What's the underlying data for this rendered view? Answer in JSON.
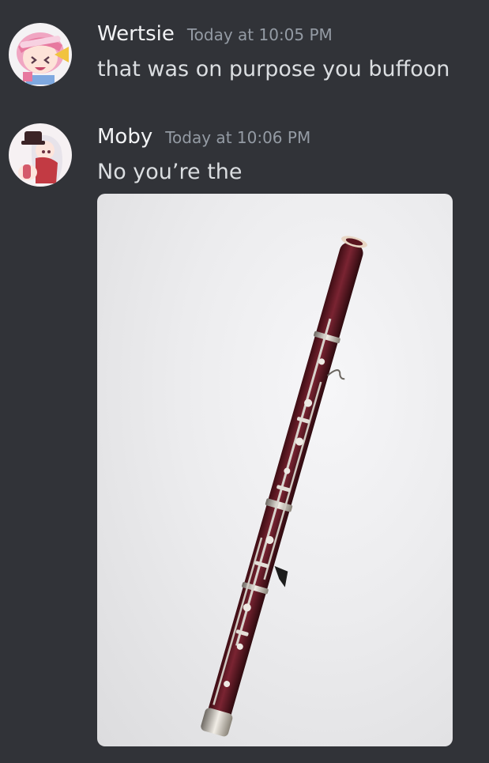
{
  "messages": [
    {
      "username": "Wertsie",
      "timestamp": "Today at 10:05 PM",
      "text": "that was on purpose you buffoon",
      "avatar_icon": "anime-pink-hair-avatar"
    },
    {
      "username": "Moby",
      "timestamp": "Today at 10:06 PM",
      "text": "No you’re the",
      "avatar_icon": "anime-white-hair-avatar",
      "attachment": {
        "type": "image",
        "subject": "bassoon-image"
      }
    }
  ],
  "colors": {
    "background": "#313338",
    "username": "#f2f3f5",
    "timestamp": "#949ba4",
    "text": "#dbdee1"
  }
}
